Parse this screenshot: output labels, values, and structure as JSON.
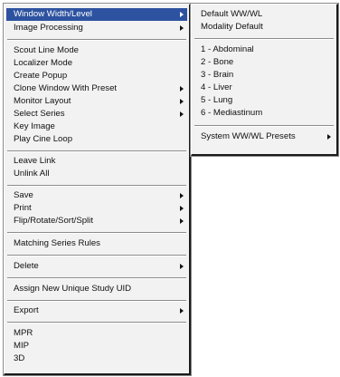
{
  "main_menu": {
    "items": [
      {
        "label": "Window Width/Level",
        "submenu": true
      },
      {
        "label": "Image Processing",
        "submenu": true
      },
      {
        "label": "Scout Line Mode",
        "submenu": false
      },
      {
        "label": "Localizer Mode",
        "submenu": false
      },
      {
        "label": "Create Popup",
        "submenu": false
      },
      {
        "label": "Clone Window With Preset",
        "submenu": true
      },
      {
        "label": "Monitor Layout",
        "submenu": true
      },
      {
        "label": "Select Series",
        "submenu": true
      },
      {
        "label": "Key Image",
        "submenu": false
      },
      {
        "label": "Play Cine Loop",
        "submenu": false
      },
      {
        "label": "Leave Link",
        "submenu": false
      },
      {
        "label": "Unlink All",
        "submenu": false
      },
      {
        "label": "Save",
        "submenu": true
      },
      {
        "label": "Print",
        "submenu": true
      },
      {
        "label": "Flip/Rotate/Sort/Split",
        "submenu": true
      },
      {
        "label": "Matching Series Rules",
        "submenu": false
      },
      {
        "label": "Delete",
        "submenu": true
      },
      {
        "label": "Assign New Unique Study UID",
        "submenu": false
      },
      {
        "label": "Export",
        "submenu": true
      },
      {
        "label": "MPR",
        "submenu": false
      },
      {
        "label": "MIP",
        "submenu": false
      },
      {
        "label": "3D",
        "submenu": false
      }
    ]
  },
  "submenu": {
    "items": [
      {
        "label": "Default WW/WL",
        "submenu": false
      },
      {
        "label": "Modality Default",
        "submenu": false
      },
      {
        "label": "1 - Abdominal",
        "submenu": false
      },
      {
        "label": "2 - Bone",
        "submenu": false
      },
      {
        "label": "3 - Brain",
        "submenu": false
      },
      {
        "label": "4 - Liver",
        "submenu": false
      },
      {
        "label": "5 - Lung",
        "submenu": false
      },
      {
        "label": "6 - Mediastinum",
        "submenu": false
      },
      {
        "label": "System WW/WL Presets",
        "submenu": true
      }
    ]
  },
  "colors": {
    "menu_background": "#f2f2f2",
    "highlight_background": "#2d52a0",
    "highlight_text": "#ffffff",
    "text": "#111111"
  },
  "icons": {
    "submenu_indicator": "triangle-right-icon"
  }
}
